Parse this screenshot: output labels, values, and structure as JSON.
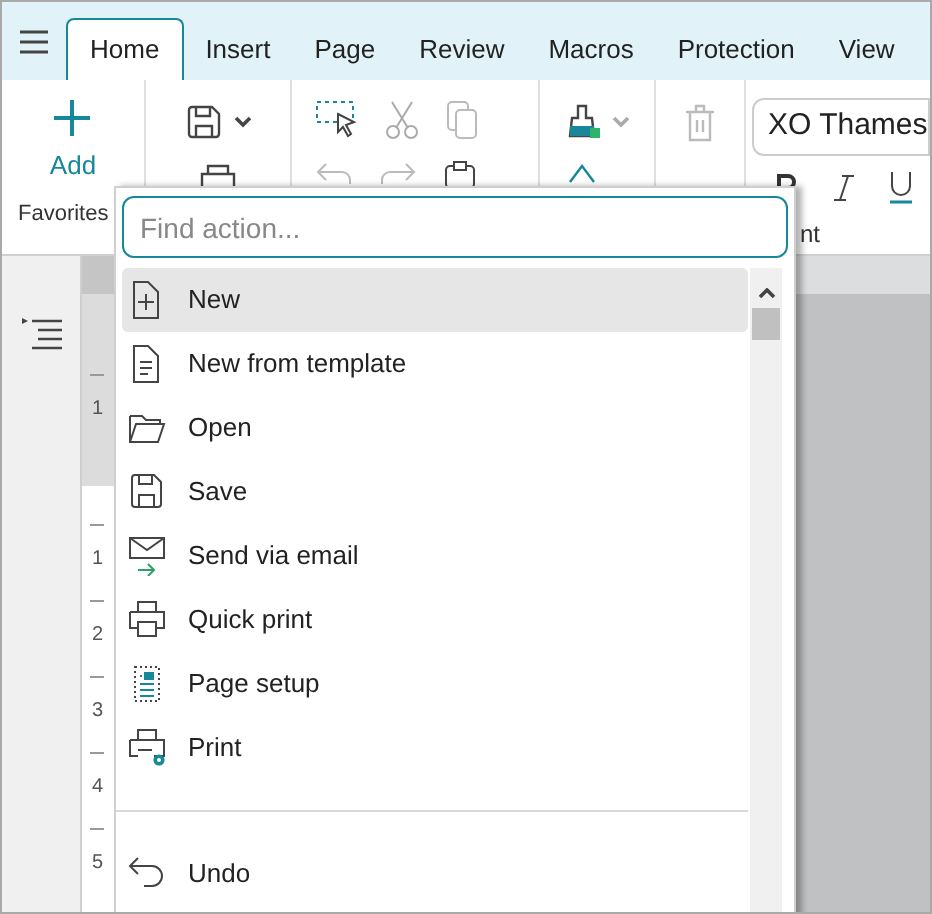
{
  "tabs": [
    {
      "label": "Home",
      "selected": true
    },
    {
      "label": "Insert",
      "selected": false
    },
    {
      "label": "Page",
      "selected": false
    },
    {
      "label": "Review",
      "selected": false
    },
    {
      "label": "Macros",
      "selected": false
    },
    {
      "label": "Protection",
      "selected": false
    },
    {
      "label": "View",
      "selected": false
    }
  ],
  "ribbon": {
    "add_button": {
      "label": "Add"
    },
    "favorites_label": "Favorites",
    "font_box": {
      "value": "XO Thames"
    },
    "font_label": "nt"
  },
  "ruler": {
    "gray_numbers": [
      "1"
    ],
    "white_numbers": [
      "1",
      "2",
      "3",
      "4",
      "5"
    ]
  },
  "find_action": {
    "search": {
      "placeholder": "Find action..."
    },
    "sections": [
      [
        {
          "label": "New",
          "selected": true
        },
        {
          "label": "New from template",
          "selected": false
        },
        {
          "label": "Open",
          "selected": false
        },
        {
          "label": "Save",
          "selected": false
        },
        {
          "label": "Send via email",
          "selected": false
        },
        {
          "label": "Quick print",
          "selected": false
        },
        {
          "label": "Page setup",
          "selected": false
        },
        {
          "label": "Print",
          "selected": false
        }
      ],
      [
        {
          "label": "Undo",
          "selected": false
        }
      ]
    ]
  }
}
